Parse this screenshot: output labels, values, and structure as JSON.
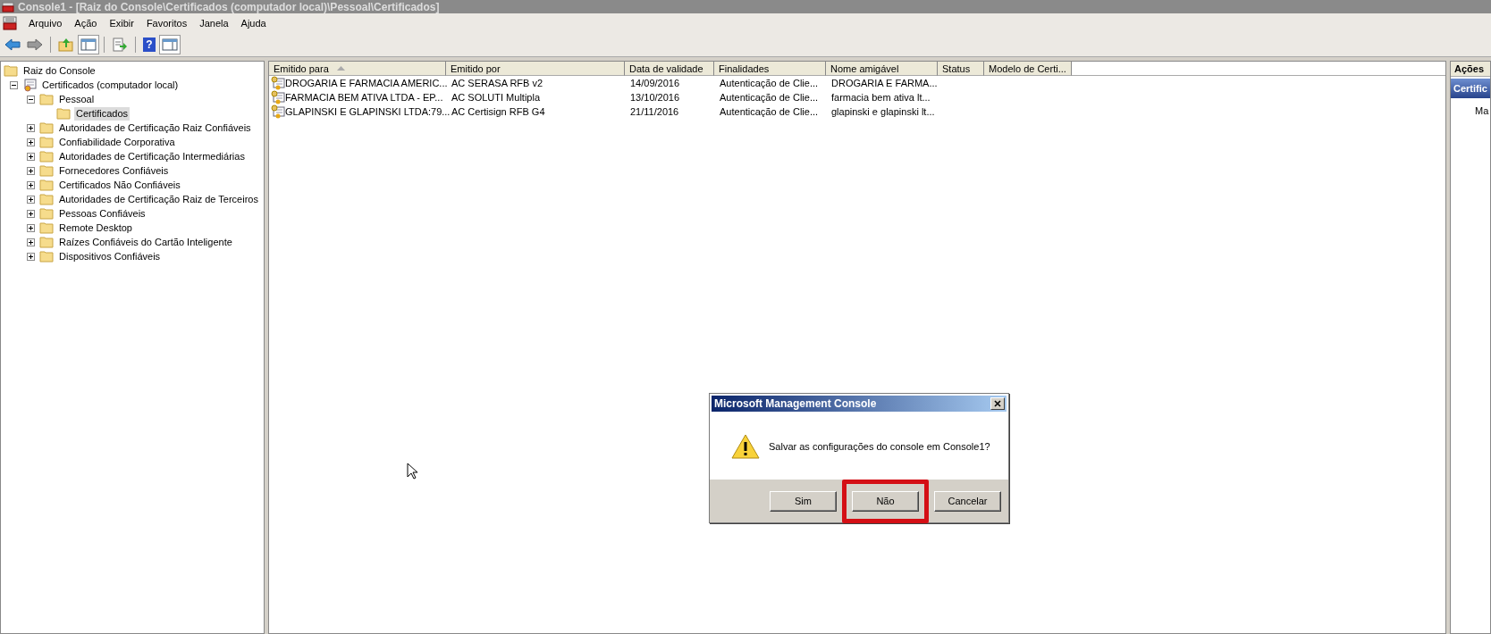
{
  "window": {
    "title": "Console1 - [Raiz do Console\\Certificados (computador local)\\Pessoal\\Certificados]"
  },
  "toolbar": {
    "help_glyph": "?"
  },
  "menu": [
    "Arquivo",
    "Ação",
    "Exibir",
    "Favoritos",
    "Janela",
    "Ajuda"
  ],
  "tree": [
    {
      "label": "Raiz do Console",
      "kind": "root",
      "selected": false,
      "children": [
        {
          "label": "Certificados (computador local)",
          "kind": "store",
          "expanded": true,
          "selected": false,
          "children": [
            {
              "label": "Pessoal",
              "kind": "folder",
              "expanded": true,
              "selected": false,
              "children": [
                {
                  "label": "Certificados",
                  "kind": "folder",
                  "selected": true
                }
              ]
            },
            {
              "label": "Autoridades de Certificação Raiz Confiáveis",
              "kind": "folder",
              "expanded": false,
              "selected": false
            },
            {
              "label": "Confiabilidade Corporativa",
              "kind": "folder",
              "expanded": false,
              "selected": false
            },
            {
              "label": "Autoridades de Certificação Intermediárias",
              "kind": "folder",
              "expanded": false,
              "selected": false
            },
            {
              "label": "Fornecedores Confiáveis",
              "kind": "folder",
              "expanded": false,
              "selected": false
            },
            {
              "label": "Certificados Não Confiáveis",
              "kind": "folder",
              "expanded": false,
              "selected": false
            },
            {
              "label": "Autoridades de Certificação Raiz de Terceiros",
              "kind": "folder",
              "expanded": false,
              "selected": false
            },
            {
              "label": "Pessoas Confiáveis",
              "kind": "folder",
              "expanded": false,
              "selected": false
            },
            {
              "label": "Remote Desktop",
              "kind": "folder",
              "expanded": false,
              "selected": false
            },
            {
              "label": "Raízes Confiáveis do Cartão Inteligente",
              "kind": "folder",
              "expanded": false,
              "selected": false
            },
            {
              "label": "Dispositivos Confiáveis",
              "kind": "folder",
              "expanded": false,
              "selected": false
            }
          ]
        }
      ]
    }
  ],
  "table": {
    "columns": [
      {
        "label": "Emitido para",
        "sorted": true
      },
      {
        "label": "Emitido por",
        "sorted": false
      },
      {
        "label": "Data de validade",
        "sorted": false
      },
      {
        "label": "Finalidades",
        "sorted": false
      },
      {
        "label": "Nome amigável",
        "sorted": false
      },
      {
        "label": "Status",
        "sorted": false
      },
      {
        "label": "Modelo de Certi...",
        "sorted": false
      }
    ],
    "rows": [
      [
        "DROGARIA E FARMACIA AMERIC...",
        "AC SERASA RFB v2",
        "14/09/2016",
        "Autenticação de Clie...",
        "DROGARIA E FARMA..."
      ],
      [
        "FARMACIA BEM ATIVA LTDA - EP...",
        "AC SOLUTI Multipla",
        "13/10/2016",
        "Autenticação de Clie...",
        "farmacia bem ativa lt..."
      ],
      [
        "GLAPINSKI E GLAPINSKI LTDA:79...",
        "AC Certisign RFB G4",
        "21/11/2016",
        "Autenticação de Clie...",
        "glapinski e glapinski lt..."
      ]
    ]
  },
  "actions": {
    "header": "Ações",
    "section": "Certific",
    "item": "Ma"
  },
  "dialog": {
    "title": "Microsoft Management Console",
    "message": "Salvar as configurações do console em Console1?",
    "buttons": [
      {
        "label": "Sim",
        "highlighted": false
      },
      {
        "label": "Não",
        "highlighted": true
      },
      {
        "label": "Cancelar",
        "highlighted": false
      }
    ]
  }
}
